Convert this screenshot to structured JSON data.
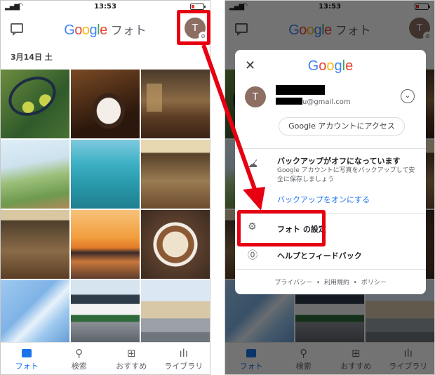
{
  "status_bar": {
    "time": "13:53"
  },
  "header": {
    "logo_letters": [
      {
        "char": "G",
        "color": "#4285F4"
      },
      {
        "char": "o",
        "color": "#EA4335"
      },
      {
        "char": "o",
        "color": "#FBBC05"
      },
      {
        "char": "g",
        "color": "#4285F4"
      },
      {
        "char": "l",
        "color": "#34A853"
      },
      {
        "char": "e",
        "color": "#EA4335"
      }
    ],
    "logo_suffix": "フォト",
    "avatar_initial": "T",
    "chat_icon": "chat-icon"
  },
  "date_label": "3月14日 土",
  "bottom_nav": {
    "items": [
      {
        "label": "フォト",
        "icon": "photo-icon",
        "active": true
      },
      {
        "label": "検索",
        "icon": "search-icon",
        "active": false
      },
      {
        "label": "おすすめ",
        "icon": "suggest-icon",
        "active": false
      },
      {
        "label": "ライブラリ",
        "icon": "library-icon",
        "active": false
      }
    ]
  },
  "account_sheet": {
    "avatar_initial": "T",
    "email_suffix": "u@gmail.com",
    "manage_account_button": "Google アカウントにアクセス",
    "backup_title": "バックアップがオフになっています",
    "backup_description": "Google アカウントに写真をバックアップして安全に保存しましょう",
    "backup_link": "バックアップをオンにする",
    "settings_label": "フォト の設定",
    "help_label": "ヘルプとフィードバック",
    "footer_privacy": "プライバシー",
    "footer_separator": "•",
    "footer_terms": "利用規約",
    "footer_policy": "ポリシー"
  },
  "colors": {
    "callout_red": "#e60012",
    "accent_blue": "#1a73e8"
  }
}
